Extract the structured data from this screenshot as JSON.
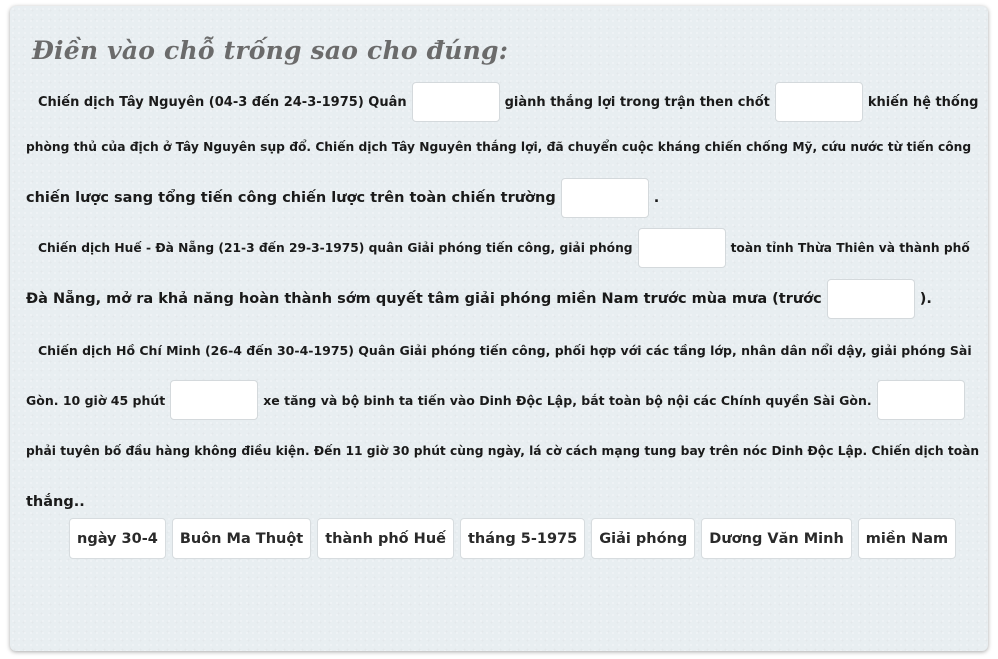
{
  "title": "Điền vào chỗ trống sao cho đúng:",
  "lines": [
    [
      "Chiến dịch Tây Nguyên (04-3 đến 24-3-1975) Quân",
      "giành thắng lợi trong trận then chốt",
      "khiến hệ thống"
    ],
    [
      "phòng thủ của địch ở Tây Nguyên sụp đổ. Chiến dịch Tây Nguyên thắng lợi, đã chuyển cuộc kháng chiến chống Mỹ, cứu nước từ tiến công"
    ],
    [
      "chiến lược sang tổng tiến công chiến lược trên toàn chiến trường",
      "."
    ],
    [
      "Chiến dịch Huế - Đà Nẵng (21-3 đến 29-3-1975) quân Giải phóng tiến công, giải phóng",
      "toàn tỉnh Thừa Thiên và thành phố"
    ],
    [
      "Đà Nẵng, mở ra khả năng hoàn thành sớm quyết tâm giải phóng miền Nam trước mùa mưa (trước",
      ")."
    ],
    [
      "Chiến dịch Hồ Chí Minh (26-4 đến 30-4-1975) Quân Giải phóng tiến công, phối hợp với các tầng lớp, nhân dân nổi dậy, giải phóng Sài"
    ],
    [
      "Gòn. 10 giờ 45 phút",
      "xe tăng và bộ binh ta tiến vào Dinh Độc Lập, bắt toàn bộ nội các Chính quyền Sài Gòn.",
      ""
    ],
    [
      "phải tuyên bố đầu hàng không điều kiện. Đến 11 giờ 30 phút cùng ngày, lá cờ cách mạng tung bay trên nóc Dinh Độc Lập. Chiến dịch toàn"
    ],
    [
      "thắng.."
    ]
  ],
  "options": [
    "ngày 30-4",
    "Buôn Ma Thuột",
    "thành phố Huế",
    "tháng 5-1975",
    "Giải phóng",
    "Dương Văn Minh",
    "miền Nam"
  ]
}
